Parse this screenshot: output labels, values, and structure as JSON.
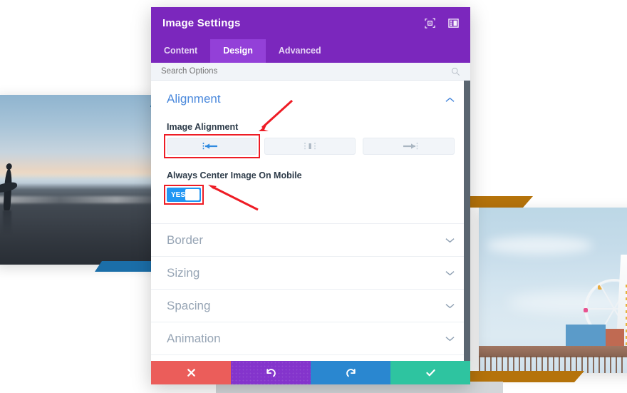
{
  "panel": {
    "title": "Image Settings",
    "header_icons": [
      {
        "name": "focus-icon",
        "label": "focus"
      },
      {
        "name": "layout-icon",
        "label": "layout"
      }
    ],
    "tabs": [
      {
        "label": "Content",
        "active": false
      },
      {
        "label": "Design",
        "active": true
      },
      {
        "label": "Advanced",
        "active": false
      }
    ],
    "search": {
      "placeholder": "Search Options",
      "value": "",
      "icon": "search-icon"
    },
    "open_section": {
      "title": "Alignment",
      "chevron": "⌃",
      "fields": {
        "image_alignment": {
          "label": "Image Alignment",
          "options": [
            {
              "value": "left",
              "icon": "align-left-icon",
              "selected": true
            },
            {
              "value": "center",
              "icon": "align-center-icon",
              "selected": false
            },
            {
              "value": "right",
              "icon": "align-right-icon",
              "selected": false
            }
          ]
        },
        "center_on_mobile": {
          "label": "Always Center Image On Mobile",
          "toggle_text": "YES",
          "value": true
        }
      }
    },
    "collapsed_sections": [
      {
        "title": "Border",
        "chevron": "⌄"
      },
      {
        "title": "Sizing",
        "chevron": "⌄"
      },
      {
        "title": "Spacing",
        "chevron": "⌄"
      },
      {
        "title": "Animation",
        "chevron": "⌄"
      }
    ],
    "footer_buttons": [
      {
        "name": "cancel-button",
        "icon": "close-icon",
        "color": "#eb5d5a"
      },
      {
        "name": "undo-button",
        "icon": "undo-icon",
        "color": "#8434cc"
      },
      {
        "name": "redo-button",
        "icon": "redo-icon",
        "color": "#2a87d0"
      },
      {
        "name": "save-button",
        "icon": "check-icon",
        "color": "#2ec4a0"
      }
    ]
  },
  "annotations": [
    {
      "name": "arrow-to-alignment-buttons",
      "color": "#ee1c25"
    },
    {
      "name": "arrow-to-mobile-toggle",
      "color": "#ee1c25"
    }
  ],
  "background": {
    "left_photo": {
      "name": "surfer-sunset-photo",
      "accent_color": "#1b6ea8"
    },
    "right_photo": {
      "name": "pier-ferris-wheel-photo",
      "accent_color": "#b5730b"
    }
  },
  "colors": {
    "header_purple": "#7b27bd",
    "tab_active_purple": "#9340d8",
    "section_blue": "#4b89dc",
    "toggle_blue": "#2196f3",
    "annotation_red": "#ee1c25"
  }
}
